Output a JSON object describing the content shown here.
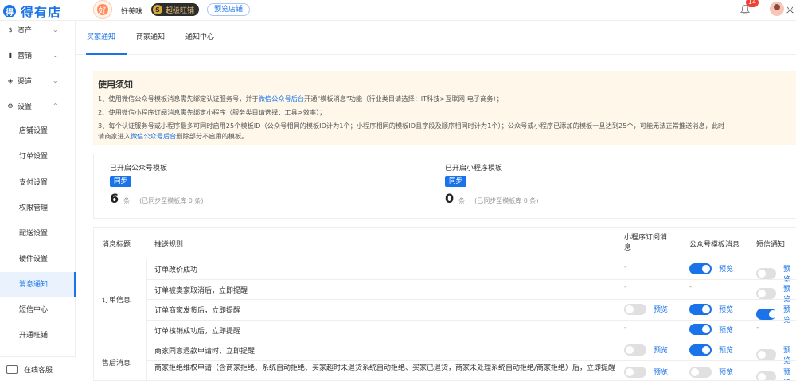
{
  "header": {
    "logo_mark": "得",
    "logo_text": "得有店",
    "store_avatar_text": "好",
    "store_name": "好美味",
    "vip_icon": "S",
    "vip_label": "超级旺铺",
    "preset_store_label": "预览店铺",
    "notification_count": "14",
    "user_name": "米"
  },
  "sidebar": {
    "groups": [
      {
        "icon": "$",
        "label": "资产"
      },
      {
        "icon": "▮",
        "label": "营销"
      },
      {
        "icon": "◈",
        "label": "渠道"
      },
      {
        "icon": "⚙",
        "label": "设置"
      }
    ],
    "sub_items": [
      "店铺设置",
      "订单设置",
      "支付设置",
      "权限管理",
      "配送设置",
      "硬件设置",
      "消息通知",
      "短信中心",
      "开通旺铺"
    ],
    "active_index": 6,
    "service_label": "在线客服"
  },
  "tabs": [
    "买家通知",
    "商家通知",
    "通知中心"
  ],
  "notice": {
    "title": "使用须知",
    "line1_a": "1、使用微信公众号模板消息需先绑定认证服务号，并于",
    "line1_link": "微信公众号后台",
    "line1_b": "开通\"模板消息\"功能（行业类目请选择：IT科技>互联网|电子商务）；",
    "line2": "2、使用微信小程序订阅消息需先绑定小程序（服务类目请选择：工具>效率）；",
    "line3": "3、每个认证服务号或小程序最多可同时启用25个模板ID（公众号相同的模板ID计为1个；小程序相同的模板ID且字段及顺序相同时计为1个）；公众号或小程序已添加的模板一旦达到25个，可能无法正常推送消息，此时",
    "line4_a": "请商家进入",
    "line4_link": "微信公众号后台",
    "line4_b": "删除部分不启用的模板。"
  },
  "stats": {
    "official": {
      "title": "已开启公众号模板",
      "sync": "同步",
      "count": "6",
      "unit": "条",
      "note": "(已同步至模板库 0 条)"
    },
    "mini": {
      "title": "已开启小程序模板",
      "sync": "同步",
      "count": "0",
      "unit": "条",
      "note": "(已同步至模板库 0 条)"
    }
  },
  "table": {
    "headers": {
      "title": "消息标题",
      "rule": "推送规则",
      "mini": "小程序订阅消息",
      "official": "公众号模板消息",
      "sms": "短信通知"
    },
    "preview_label": "预览",
    "dash": "-",
    "groups": [
      {
        "name": "订单信息",
        "rows": [
          {
            "rule": "订单改价成功",
            "mini": "dash",
            "official": "on",
            "sms": "off"
          },
          {
            "rule": "订单被卖家取消后，立即提醒",
            "mini": "dash",
            "official": "dash",
            "sms": "off"
          },
          {
            "rule": "订单商家发货后，立即提醒",
            "mini": "off",
            "official": "on",
            "sms": "on"
          },
          {
            "rule": "订单核销成功后，立即提醒",
            "mini": "dash",
            "official": "on",
            "sms": "dash"
          }
        ]
      },
      {
        "name": "售后消息",
        "rows": [
          {
            "rule": "商家同意退款申请时，立即提醒",
            "mini": "off",
            "official": "on",
            "sms": "off"
          },
          {
            "rule": "商家拒绝维权申请（含商家拒绝、系统自动拒绝、买家超时未退货系统自动拒绝、买家已退货，商家未处理系统自动拒绝/商家拒绝）后，立即提醒",
            "mini": "off",
            "official": "off",
            "sms": "off"
          }
        ]
      }
    ]
  },
  "colors": {
    "accent": "#1a73e8",
    "notice_bg": "#fff8ea",
    "toggle_off": "#e0e0e0",
    "badge": "#f04134"
  }
}
